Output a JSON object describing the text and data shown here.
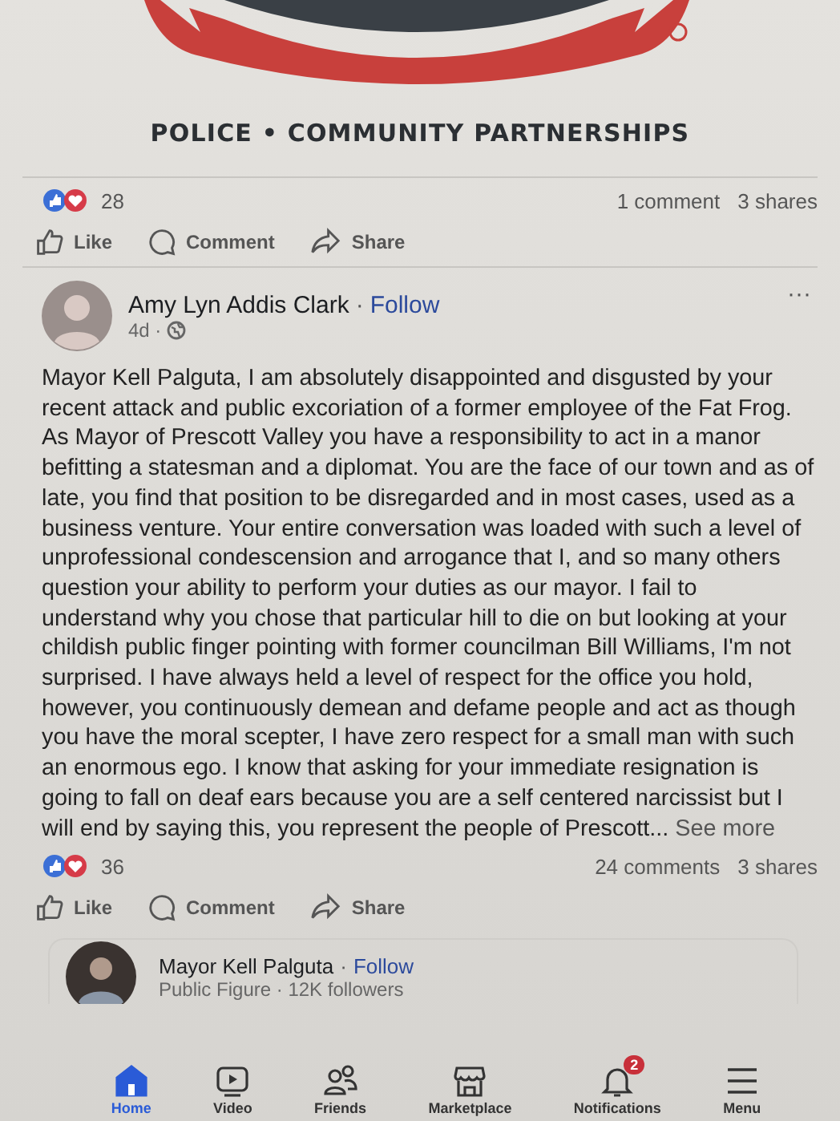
{
  "shared_post": {
    "tagline": "POLICE • COMMUNITY PARTNERSHIPS",
    "reaction_count": "28",
    "comments": "1 comment",
    "shares": "3 shares",
    "actions": [
      "Like",
      "Comment",
      "Share"
    ]
  },
  "post": {
    "author": "Amy Lyn Addis Clark",
    "separator": "·",
    "follow": "Follow",
    "time": "4d ·",
    "menu": "···",
    "body": "Mayor Kell Palguta, I am absolutely disappointed and disgusted by your recent attack and public excoriation of a former employee of the Fat Frog. As Mayor of Prescott Valley you have a responsibility to act in a manor befitting a statesman and a diplomat. You are the face of our town and as of late, you find that position to be disregarded and in most cases, used as a business venture. Your entire conversation was loaded with such a level of unprofessional condescension and arrogance that I, and so many others question your ability to perform your duties as our mayor. I fail to understand why you chose that particular hill to die on but looking at your childish public finger pointing with former councilman Bill Williams, I'm not surprised. I have always held a level of respect for the office you hold, however, you continuously demean and defame people and act as though you have the moral scepter, I have zero respect for a small man with such an enormous ego. I know that asking for your immediate resignation is going to fall on deaf ears because you are a self centered narcissist but I will end by saying this, you represent the people of Prescott...",
    "see_more": "See more",
    "reaction_count": "36",
    "comments": "24 comments",
    "shares": "3 shares",
    "actions": [
      "Like",
      "Comment",
      "Share"
    ]
  },
  "page_card": {
    "name": "Mayor Kell Palguta",
    "separator": "·",
    "follow": "Follow",
    "subtitle": "Public Figure · 12K followers"
  },
  "nav": [
    {
      "label": "Home",
      "selected": true
    },
    {
      "label": "Video",
      "selected": false
    },
    {
      "label": "Friends",
      "selected": false
    },
    {
      "label": "Marketplace",
      "selected": false
    },
    {
      "label": "Notifications",
      "selected": false,
      "badge": "2"
    },
    {
      "label": "Menu",
      "selected": false
    }
  ]
}
